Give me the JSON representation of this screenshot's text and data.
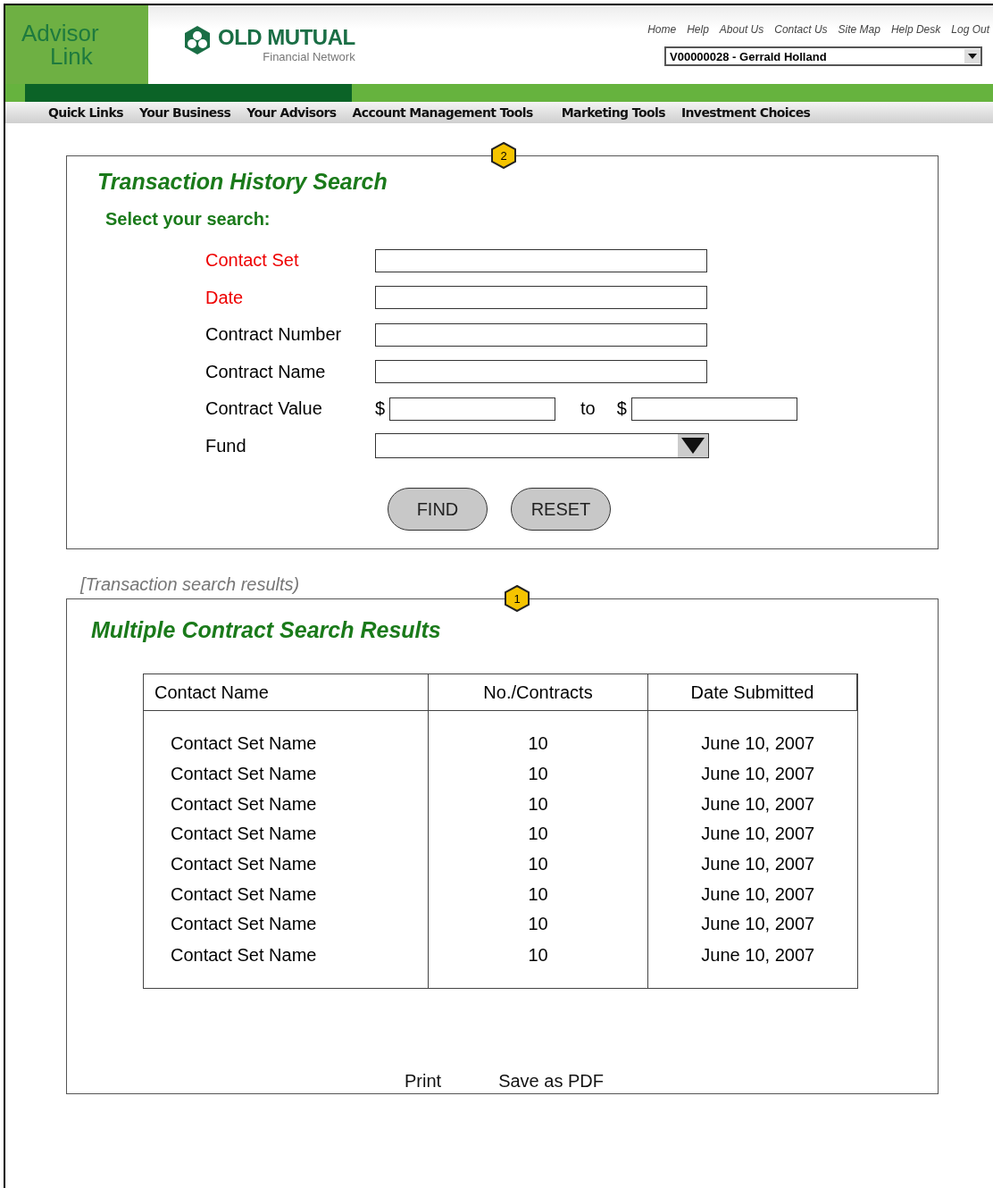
{
  "header": {
    "logo": {
      "line_1": "Advisor",
      "line_2": "Link"
    },
    "brand": {
      "name": "OLD MUTUAL",
      "tagline": "Financial Network"
    },
    "utility_links": [
      "Home",
      "Help",
      "About Us",
      "Contact Us",
      "Site Map",
      "Help Desk",
      "Log Out"
    ],
    "advisor_select": {
      "value": "V00000028 - Gerrald Holland"
    }
  },
  "nav": [
    "Quick Links",
    "Your Business",
    "Your Advisors",
    "Account Management Tools",
    "Marketing Tools",
    "Investment Choices"
  ],
  "search_panel": {
    "badge": "2",
    "title": "Transaction History Search",
    "subtitle": "Select your search:",
    "fields": [
      {
        "kind": "text",
        "label": "Contact Set",
        "required": true
      },
      {
        "kind": "text",
        "label": "Date",
        "required": true
      },
      {
        "kind": "text",
        "label": "Contract Number",
        "required": false
      },
      {
        "kind": "text",
        "label": "Contract Name",
        "required": false
      },
      {
        "kind": "range",
        "label": "Contract Value",
        "required": false,
        "currency_from": "$",
        "separator": "to",
        "currency_to": "$"
      },
      {
        "kind": "select",
        "label": "Fund",
        "required": false
      }
    ],
    "buttons": [
      "FIND",
      "RESET"
    ]
  },
  "results_note": "[Transaction search results)",
  "results_panel": {
    "title": "Multiple Contract Search Results",
    "badge": "1",
    "table": {
      "columns": [
        "Contact Name",
        "No./Contracts",
        "Date Submitted"
      ],
      "rows": [
        [
          "Contact Set Name",
          "10",
          "June 10, 2007"
        ],
        [
          "Contact Set Name",
          "10",
          "June 10, 2007"
        ],
        [
          "Contact Set Name",
          "10",
          "June 10, 2007"
        ],
        [
          "Contact Set Name",
          "10",
          "June 10, 2007"
        ],
        [
          "Contact Set Name",
          "10",
          "June 10, 2007"
        ],
        [
          "Contact Set Name",
          "10",
          "June 10, 2007"
        ],
        [
          "Contact Set Name",
          "10",
          "June 10, 2007"
        ],
        [
          "Contact Set Name",
          "10",
          "June 10, 2007"
        ]
      ]
    },
    "links": [
      "Print",
      "Save as PDF"
    ]
  }
}
